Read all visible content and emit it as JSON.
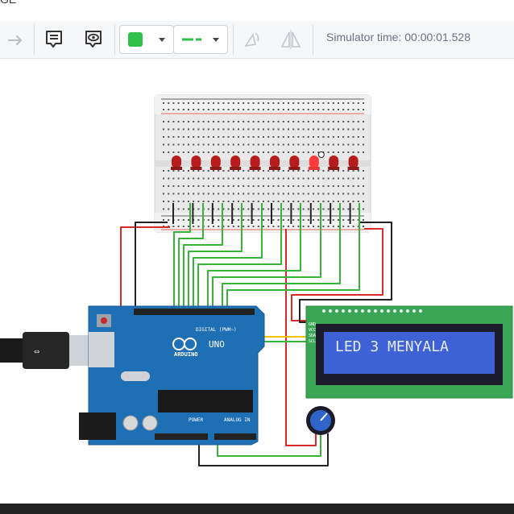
{
  "window": {
    "title_fragment": "GE"
  },
  "toolbar": {
    "redo_icon": "redo-arrow-icon",
    "notes_icon": "notes-icon",
    "visibility_icon": "eye-icon",
    "color_value": "#2fc24b",
    "wire_style_icon": "wire-style-icon",
    "rotate_icon": "rotate-icon",
    "flip_icon": "flip-icon",
    "simulator_time": "Simulator time: 00:00:01.528"
  },
  "circuit": {
    "lcd_text": "LED 3 MENYALA",
    "lcd_pins": [
      "GND",
      "VCC",
      "SDA",
      "SCL"
    ],
    "arduino_logo": "ARDUINO",
    "arduino_model": "UNO",
    "digital_label": "DIGITAL (PWM~)",
    "power_label": "POWER",
    "analog_label": "ANALOG IN",
    "led_count": 10,
    "lit_led_index": 7,
    "colors": {
      "led_off": "#b71c1c",
      "led_on": "#ff3b3b",
      "board": "#1f6fb5",
      "lcd_pcb": "#3aa655",
      "lcd_screen": "#3f61d6",
      "wire_green": "#35b53a",
      "wire_red": "#d92a2a",
      "wire_black": "#222222",
      "wire_yellow": "#f2c300"
    }
  }
}
